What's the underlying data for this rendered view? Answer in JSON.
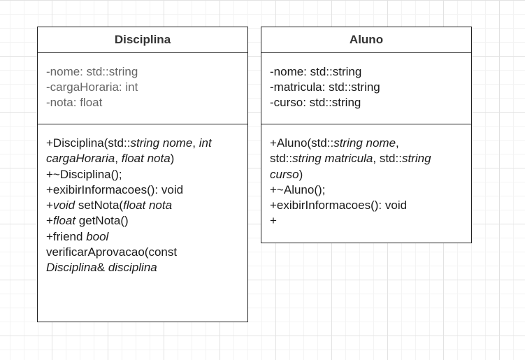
{
  "classes": {
    "disciplina": {
      "name": "Disciplina",
      "attributes": [
        "-nome: std::string",
        "-cargaHoraria: int",
        "-nota: float"
      ],
      "methods": {
        "m1": {
          "a": "+Disciplina(std::",
          "b": "string nome",
          "c": ", ",
          "d": "int"
        },
        "m2": {
          "a": "cargaHoraria",
          "b": ", ",
          "c": "float nota",
          "d": ")"
        },
        "m3": "+~Disciplina();",
        "m4": "+exibirInformacoes(): void",
        "m5": {
          "a": " +",
          "b": "void",
          "c": " setNota(",
          "d": "float nota"
        },
        "m6": {
          "a": "+",
          "b": "float",
          "c": " getNota()"
        },
        "m7": {
          "a": "+friend ",
          "b": "bool"
        },
        "m8": "verificarAprovacao(const",
        "m9": {
          "a": "Disciplina",
          "b": "& ",
          "c": "disciplina"
        }
      }
    },
    "aluno": {
      "name": "Aluno",
      "attributes": [
        "-nome: std::string",
        "-matricula: std::string",
        "-curso: std::string"
      ],
      "methods": {
        "m1": {
          "a": "+Aluno(std::",
          "b": "string nome",
          "c": ","
        },
        "m2": {
          "a": "std::",
          "b": "string matricula",
          "c": ", std::",
          "d": "string"
        },
        "m3": {
          "a": "curso",
          "b": ")"
        },
        "m4": "+~Aluno();",
        "m5": "+exibirInformacoes(): void",
        "m6": "+"
      }
    }
  }
}
